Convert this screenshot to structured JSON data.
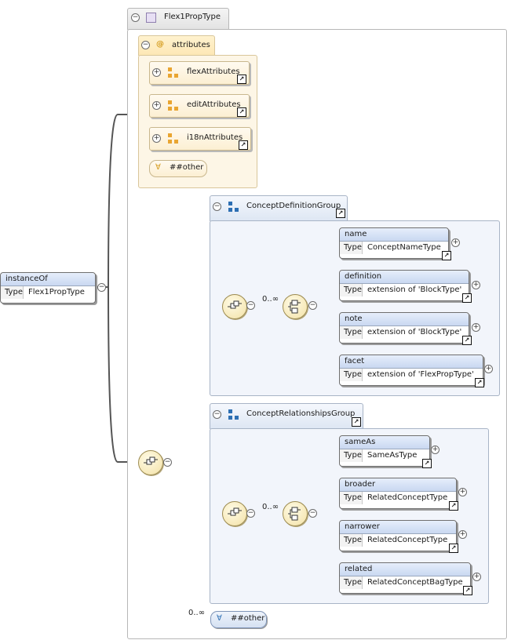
{
  "complex_type": {
    "name": "Flex1PropType"
  },
  "attributes": {
    "label": "attributes",
    "at_icon": "@",
    "groups": [
      {
        "name": "flexAttributes"
      },
      {
        "name": "editAttributes"
      },
      {
        "name": "i18nAttributes"
      }
    ],
    "any": "##other"
  },
  "root": {
    "name": "instanceOf",
    "type_key": "Type",
    "type_value": "Flex1PropType"
  },
  "groups": [
    {
      "name": "ConceptDefinitionGroup",
      "occurrence": "0..∞",
      "elements": [
        {
          "name": "name",
          "type_key": "Type",
          "type_value": "ConceptNameType"
        },
        {
          "name": "definition",
          "type_key": "Type",
          "type_value": "extension of 'BlockType'"
        },
        {
          "name": "note",
          "type_key": "Type",
          "type_value": "extension of 'BlockType'"
        },
        {
          "name": "facet",
          "type_key": "Type",
          "type_value": "extension of 'FlexPropType'"
        }
      ]
    },
    {
      "name": "ConceptRelationshipsGroup",
      "occurrence": "0..∞",
      "elements": [
        {
          "name": "sameAs",
          "type_key": "Type",
          "type_value": "SameAsType"
        },
        {
          "name": "broader",
          "type_key": "Type",
          "type_value": "RelatedConceptType"
        },
        {
          "name": "narrower",
          "type_key": "Type",
          "type_value": "RelatedConceptType"
        },
        {
          "name": "related",
          "type_key": "Type",
          "type_value": "RelatedConceptBagType"
        }
      ]
    }
  ],
  "any_element": {
    "occurrence": "0..∞",
    "label": "##other",
    "icon": "wildcard-icon"
  },
  "glyphs": {
    "collapse": "−",
    "expand": "+",
    "link": "↗",
    "wildcard": "∀"
  },
  "colors": {
    "attribute_bg": "#fdf6e6",
    "group_bg": "#f2f5fb",
    "element_header": "#c9d8f1",
    "compositor": "#f3e1a5"
  }
}
